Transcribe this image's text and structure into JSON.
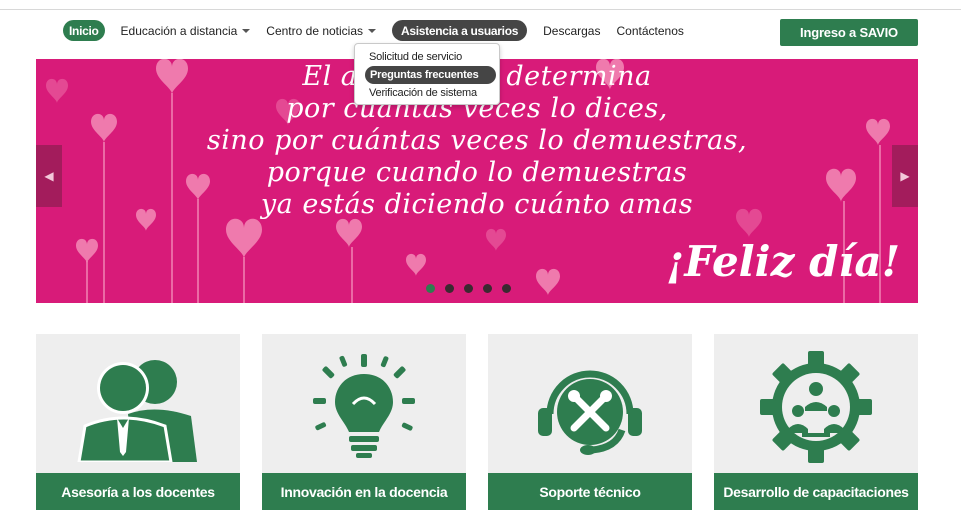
{
  "nav": {
    "items": [
      {
        "label": "Inicio",
        "style": "pill",
        "caret": false
      },
      {
        "label": "Educación a distancia",
        "style": "plain",
        "caret": true
      },
      {
        "label": "Centro de noticias",
        "style": "plain",
        "caret": true
      },
      {
        "label": "Asistencia a usuarios",
        "style": "pill-dark",
        "caret": false
      },
      {
        "label": "Descargas",
        "style": "plain",
        "caret": false
      },
      {
        "label": "Contáctenos",
        "style": "plain",
        "caret": false
      }
    ],
    "cta_label": "Ingreso a SAVIO"
  },
  "dropdown": {
    "items": [
      {
        "label": "Solicitud de servicio"
      },
      {
        "label": "Preguntas frecuentes"
      },
      {
        "label": "Verificación de sistema"
      }
    ]
  },
  "banner": {
    "quote_lines": [
      "El amor no se determina",
      "por cuántas veces lo dices,",
      "sino por cuántas veces lo demuestras,",
      "porque cuando lo demuestras",
      "ya estás diciendo cuánto amas"
    ],
    "greeting": "¡Feliz día!",
    "prev_icon": "chevron-left-icon",
    "next_icon": "chevron-right-icon",
    "slide_count": 5,
    "active_slide": 1,
    "colors": {
      "background": "#d81b79",
      "heart_light": "#f48cb8",
      "heart_mid": "#e8559a"
    }
  },
  "cards": [
    {
      "label": "Asesoría a los docentes",
      "icon": "teachers-icon"
    },
    {
      "label": "Innovación en la docencia",
      "icon": "lightbulb-icon"
    },
    {
      "label": "Soporte técnico",
      "icon": "tools-headset-icon"
    },
    {
      "label": "Desarrollo de capacitaciones",
      "icon": "training-gear-icon"
    }
  ],
  "colors": {
    "accent": "#2e7d4f",
    "card_bg": "#eeeeee"
  }
}
